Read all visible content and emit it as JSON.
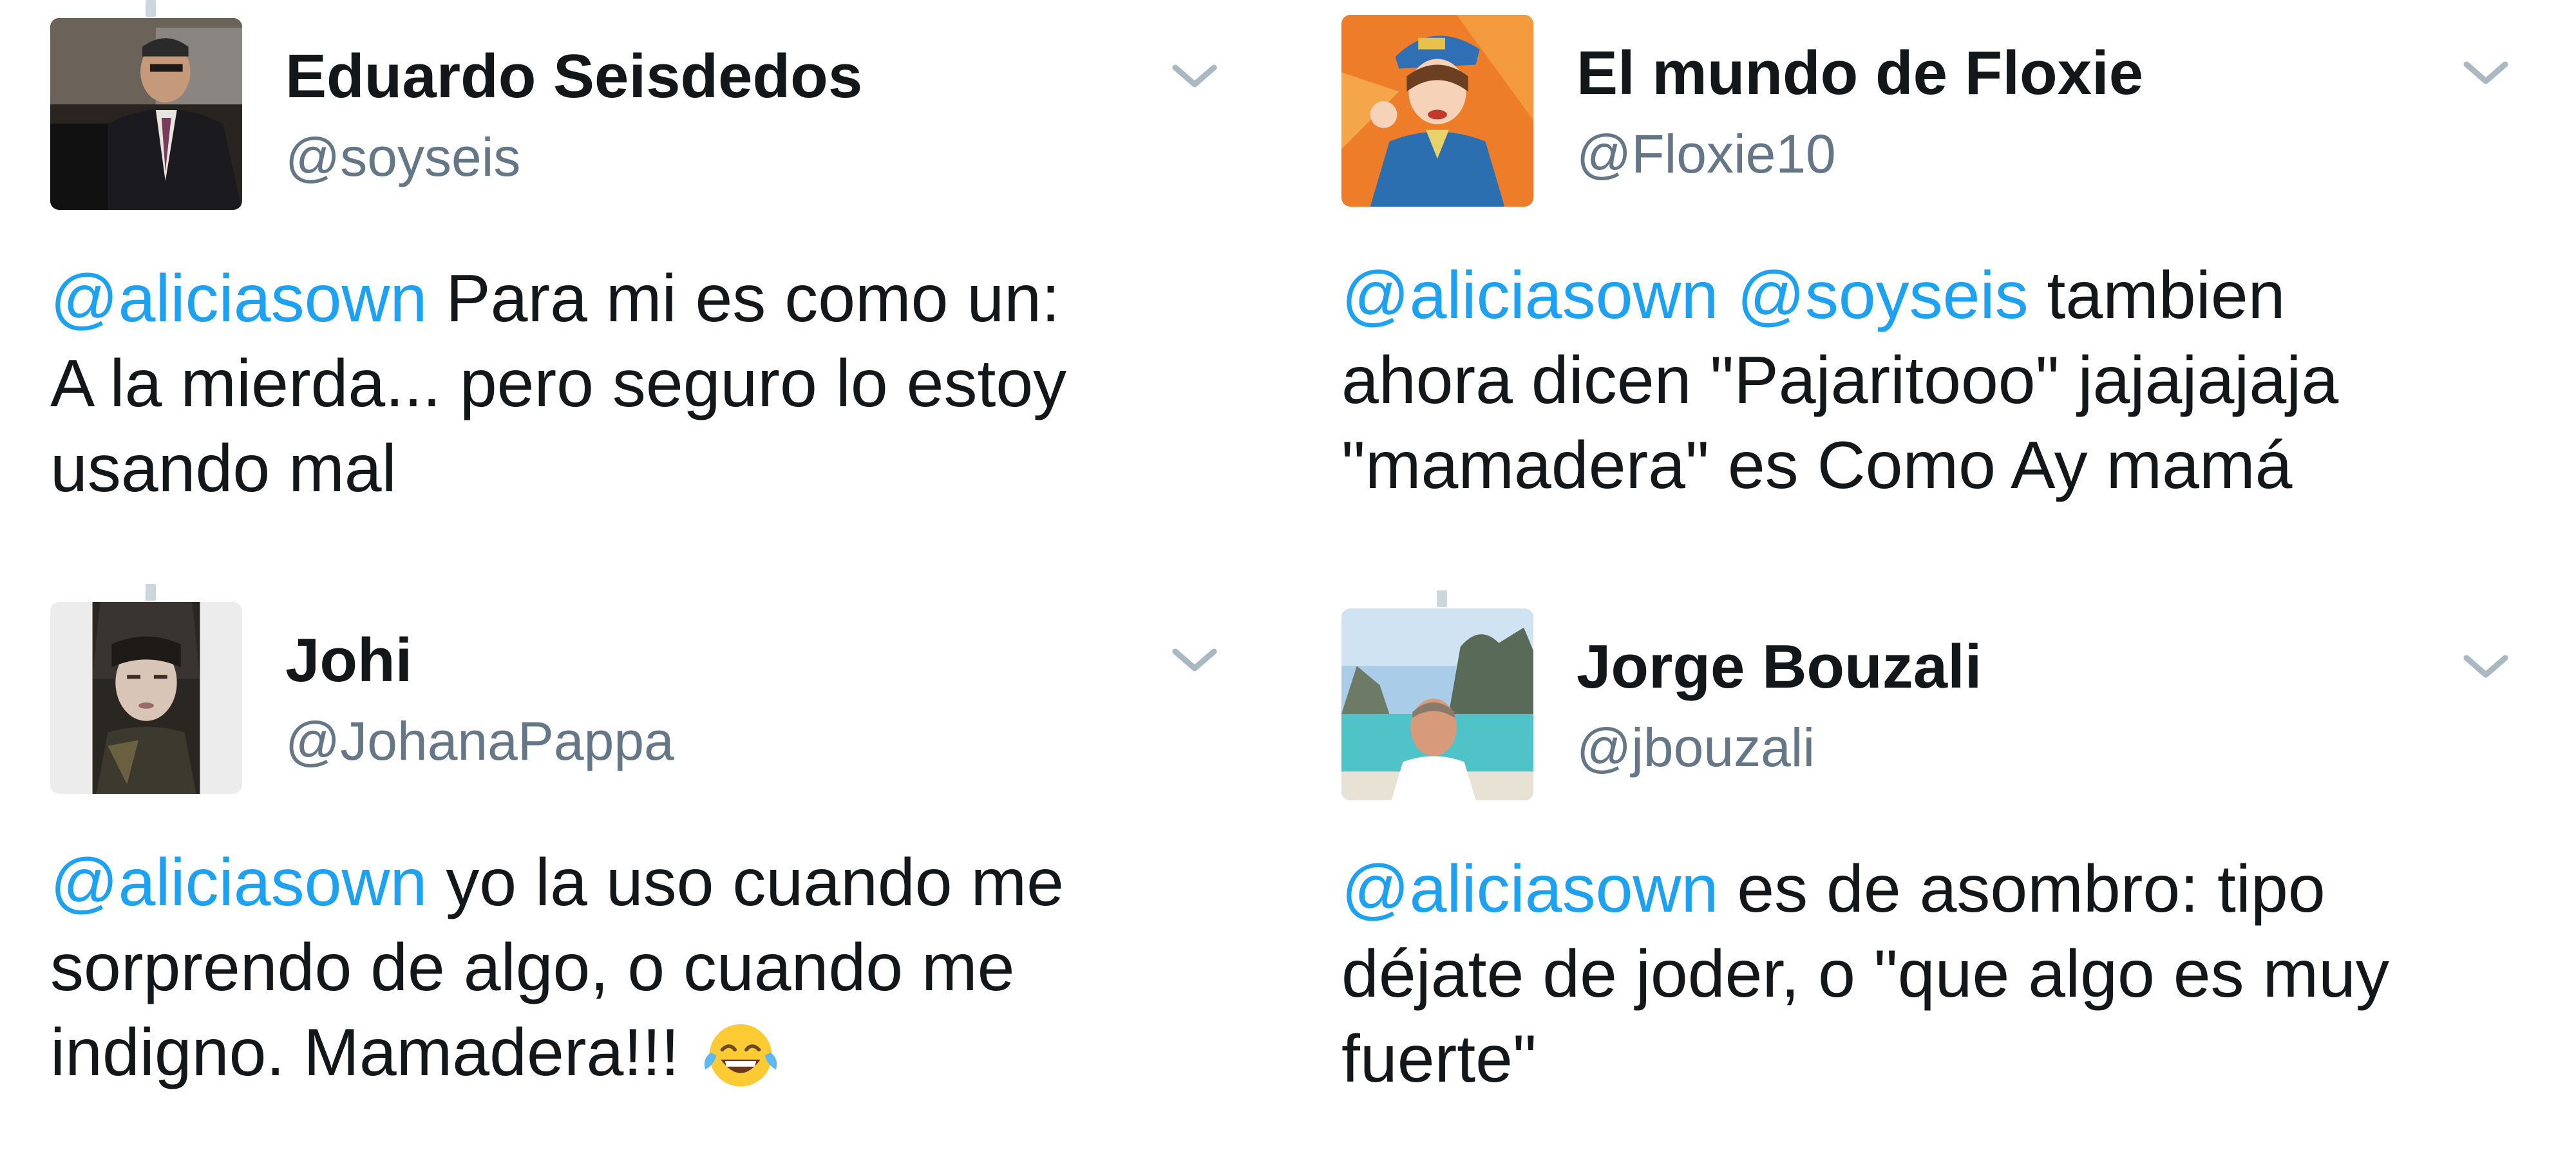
{
  "tweets": [
    {
      "name": "Eduardo Seisdedos",
      "handle": "@soyseis",
      "text_lines": [
        {
          "mentions": [
            "@aliciasown"
          ],
          "text": " Para mi es como un:"
        },
        {
          "text": "A la mierda... pero seguro lo estoy"
        },
        {
          "text": "usando mal"
        }
      ]
    },
    {
      "name": "El mundo de Floxie",
      "handle": "@Floxie10",
      "text_lines": [
        {
          "mentions": [
            "@aliciasown",
            "@soyseis"
          ],
          "text": " tambien"
        },
        {
          "text": "ahora dicen \"Pajaritooo\" jajajajaja"
        },
        {
          "text": "\"mamadera\" es Como Ay mamá"
        }
      ]
    },
    {
      "name": "Johi",
      "handle": "@JohanaPappa",
      "text_lines": [
        {
          "mentions": [
            "@aliciasown"
          ],
          "text": " yo la uso cuando me"
        },
        {
          "text": "sorprendo de algo, o cuando me"
        },
        {
          "text": "indigno. Mamadera!!! ",
          "emoji": "tears-of-joy-emoji"
        }
      ]
    },
    {
      "name": "Jorge Bouzali",
      "handle": "@jbouzali",
      "text_lines": [
        {
          "mentions": [
            "@aliciasown"
          ],
          "text": " es de asombro: tipo"
        },
        {
          "text": "déjate de joder, o \"que algo es muy"
        },
        {
          "text": "fuerte\""
        }
      ]
    }
  ],
  "colors": {
    "mention": "#1da1f2",
    "name": "#14171a",
    "handle": "#657786",
    "caret": "#aab8c2"
  }
}
